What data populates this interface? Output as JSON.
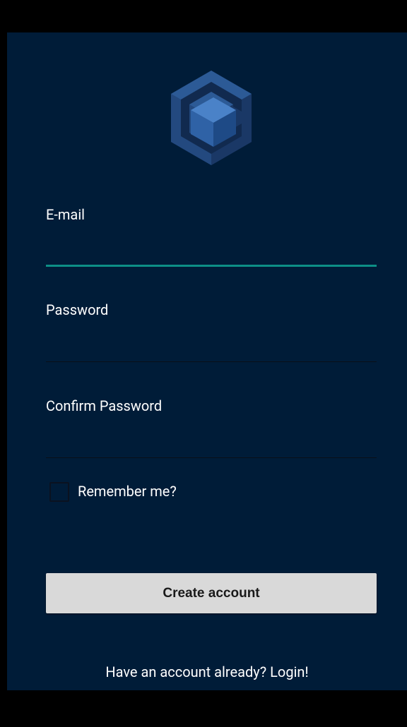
{
  "colors": {
    "background": "#001c38",
    "accent": "#0d8f86",
    "button_bg": "#d9d9d9",
    "logo_blue": "#2b5a9a"
  },
  "logo": {
    "icon": "cube-logo-icon"
  },
  "form": {
    "email": {
      "label": "E-mail",
      "value": "",
      "focused": true
    },
    "password": {
      "label": "Password",
      "value": ""
    },
    "confirm_password": {
      "label": "Confirm Password",
      "value": ""
    },
    "remember": {
      "label": "Remember me?",
      "checked": false
    },
    "submit_label": "Create account"
  },
  "footer": {
    "login_prompt": "Have an account already? Login!"
  }
}
